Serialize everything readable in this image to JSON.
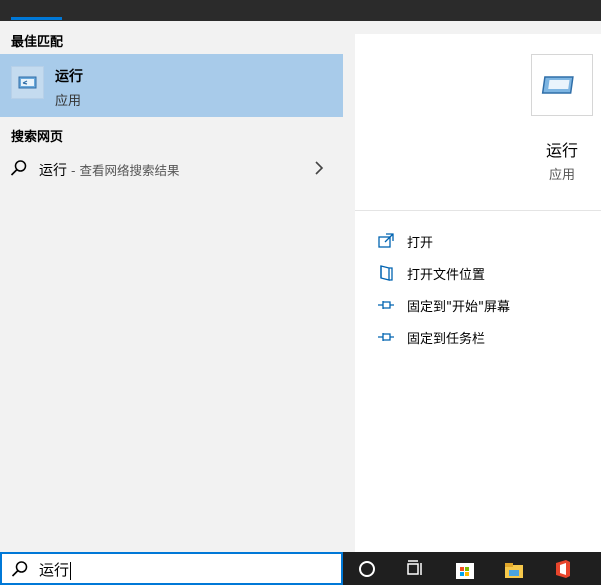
{
  "left": {
    "best_match_title": "最佳匹配",
    "best_match": {
      "name": "运行",
      "type": "应用"
    },
    "web_title": "搜索网页",
    "web_result": {
      "query": "运行",
      "suffix": " - 查看网络搜索结果"
    }
  },
  "right": {
    "name": "运行",
    "type": "应用",
    "actions": [
      {
        "label": "打开",
        "icon": "open-icon"
      },
      {
        "label": "打开文件位置",
        "icon": "file-location-icon"
      },
      {
        "label": "固定到\"开始\"屏幕",
        "icon": "pin-icon"
      },
      {
        "label": "固定到任务栏",
        "icon": "pin-icon"
      }
    ]
  },
  "search": {
    "value": "运行"
  },
  "taskbar": {
    "icons": [
      "cortana-icon",
      "task-view-icon",
      "store-icon",
      "file-explorer-icon",
      "office-icon"
    ]
  },
  "colors": {
    "accent": "#0078d7",
    "selected": "#a8cbea"
  }
}
